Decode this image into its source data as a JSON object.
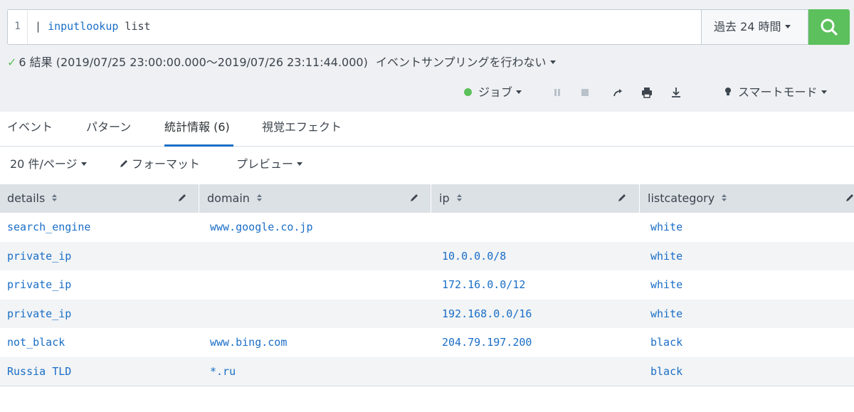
{
  "search": {
    "line_number": "1",
    "query_pipe": "| ",
    "query_command": "inputlookup",
    "query_args": " list",
    "time_range": "過去 24 時間"
  },
  "status": {
    "result_summary": "6 結果 (2019/07/25 23:00:00.000〜2019/07/26 23:11:44.000)",
    "sampling": "イベントサンプリングを行わない"
  },
  "job_bar": {
    "job_label": "ジョブ",
    "smart_mode": "スマートモード"
  },
  "tabs": [
    {
      "label": "イベント",
      "active": false
    },
    {
      "label": "パターン",
      "active": false
    },
    {
      "label": "統計情報 (6)",
      "active": true
    },
    {
      "label": "視覚エフェクト",
      "active": false
    }
  ],
  "table_options": {
    "per_page": "20 件/ページ",
    "format": "フォーマット",
    "preview": "プレビュー"
  },
  "table": {
    "columns": [
      "details",
      "domain",
      "ip",
      "listcategory"
    ],
    "rows": [
      [
        "search_engine",
        "www.google.co.jp",
        "",
        "white"
      ],
      [
        "private_ip",
        "",
        "10.0.0.0/8",
        "white"
      ],
      [
        "private_ip",
        "",
        "172.16.0.0/12",
        "white"
      ],
      [
        "private_ip",
        "",
        "192.168.0.0/16",
        "white"
      ],
      [
        "not_black",
        "www.bing.com",
        "204.79.197.200",
        "black"
      ],
      [
        "Russia TLD",
        "*.ru",
        "",
        "black"
      ]
    ]
  },
  "colors": {
    "accent": "#1a6ec7",
    "search_button": "#5cc05c",
    "header_bg": "#eef0f3",
    "table_header_bg": "#dce1e6"
  }
}
